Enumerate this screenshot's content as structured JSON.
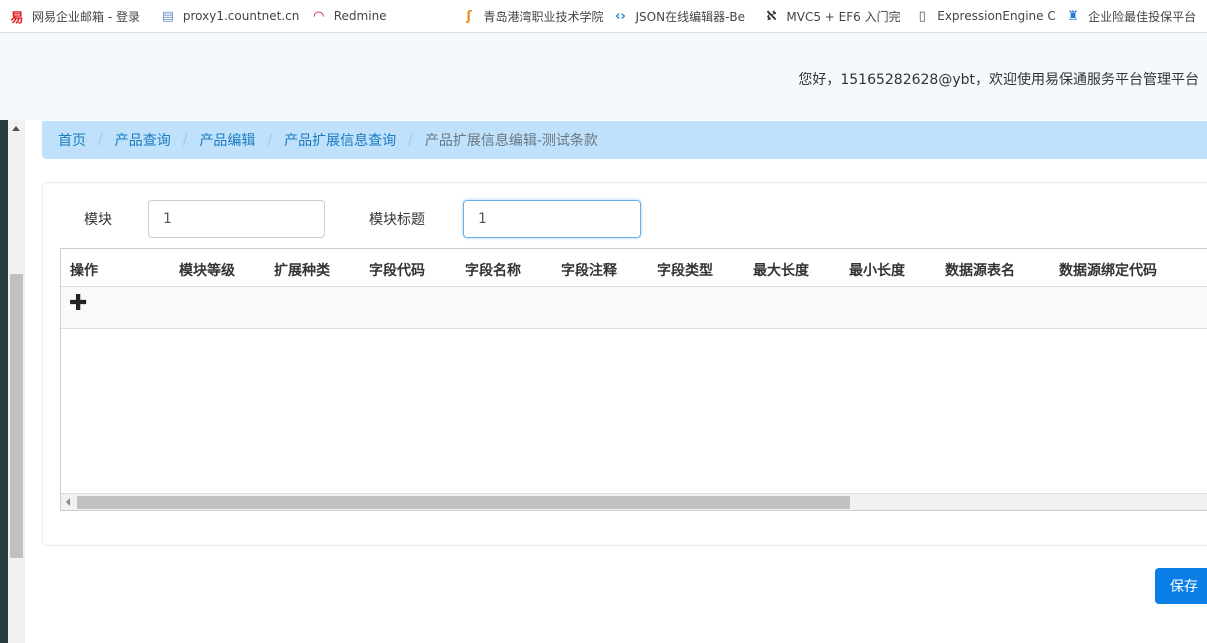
{
  "bookmarks": [
    {
      "icon": "mail-163-icon",
      "glyph": "易",
      "color": "#e0201f",
      "label": "网易企业邮箱 - 登录"
    },
    {
      "icon": "document-icon",
      "glyph": "▤",
      "color": "#6a8fc8",
      "label": "proxy1.countnet.cn"
    },
    {
      "icon": "redmine-icon",
      "glyph": "◠",
      "color": "#b2151b",
      "label": "Redmine"
    },
    {
      "icon": "school-icon",
      "glyph": "ʃ",
      "color": "#f08a1c",
      "label": "青岛港湾职业技术学院"
    },
    {
      "icon": "json-editor-icon",
      "glyph": "‹›",
      "color": "#1a86d0",
      "label": "JSON在线编辑器-Be"
    },
    {
      "icon": "mvc-icon",
      "glyph": "ℵ",
      "color": "#333",
      "label": "MVC5 + EF6 入门完"
    },
    {
      "icon": "page-icon",
      "glyph": "▯",
      "color": "#555",
      "label": "ExpressionEngine C"
    },
    {
      "icon": "insurance-icon",
      "glyph": "♜",
      "color": "#2a7bd6",
      "label": "企业险最佳投保平台"
    }
  ],
  "header": {
    "welcome": "您好，15165282628@ybt，欢迎使用易保通服务平台管理平台"
  },
  "breadcrumb": {
    "items": [
      "首页",
      "产品查询",
      "产品编辑",
      "产品扩展信息查询"
    ],
    "current": "产品扩展信息编辑-测试条款",
    "separator": "/"
  },
  "form": {
    "module_label": "模块",
    "module_value": "1",
    "title_label": "模块标题",
    "title_value": "1"
  },
  "grid": {
    "columns": [
      "操作",
      "模块等级",
      "扩展种类",
      "字段代码",
      "字段名称",
      "字段注释",
      "字段类型",
      "最大长度",
      "最小长度",
      "数据源表名",
      "数据源绑定代码"
    ],
    "add_icon": "plus-icon",
    "add_glyph": "✚"
  },
  "actions": {
    "save": "保存"
  },
  "colors": {
    "accent": "#0a7ee6",
    "breadcrumb_bg": "#bfe1fb"
  }
}
